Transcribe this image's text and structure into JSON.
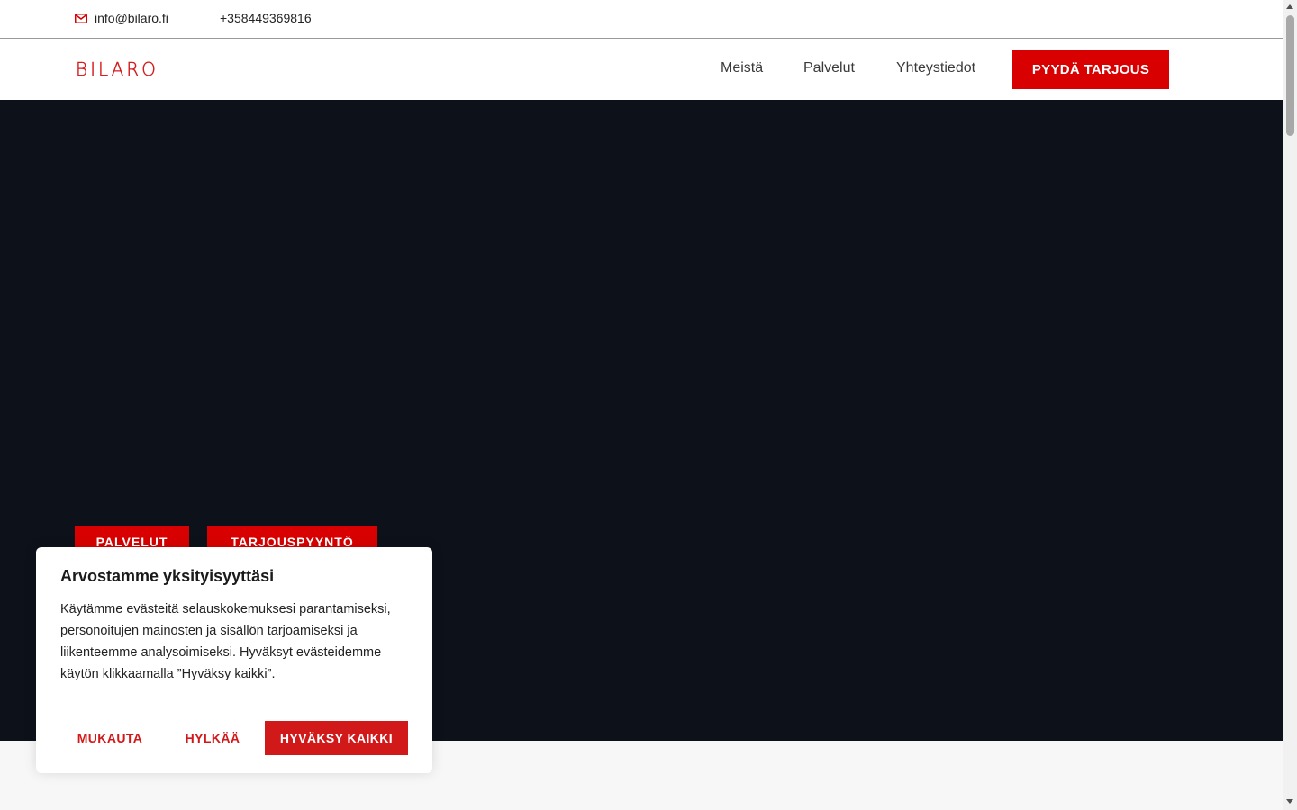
{
  "topbar": {
    "email": "info@bilaro.fi",
    "email_icon": "mail-icon",
    "phone": "+358449369816"
  },
  "header": {
    "logo_text": "BILARO",
    "nav": [
      "Meistä",
      "Palvelut",
      "Yhteystiedot"
    ],
    "cta_label": "PYYDÄ TARJOUS"
  },
  "hero": {
    "buttons": [
      "PALVELUT",
      "TARJOUSPYYNTÖ"
    ]
  },
  "cookie": {
    "title": "Arvostamme yksityisyyttäsi",
    "text": "Käytämme evästeitä selauskokemuksesi parantamiseksi, personoitujen mainosten ja sisällön tarjoamiseksi ja liikenteemme analysoimiseksi. Hyväksyt evästeidemme käytön klikkaamalla ”Hyväksy kaikki”.",
    "customize_label": "MUKAUTA",
    "reject_label": "HYLKÄÄ",
    "accept_label": "HYVÄKSY KAIKKI"
  },
  "colors": {
    "brand_red": "#d80000",
    "hero_bg": "#0d111a"
  }
}
